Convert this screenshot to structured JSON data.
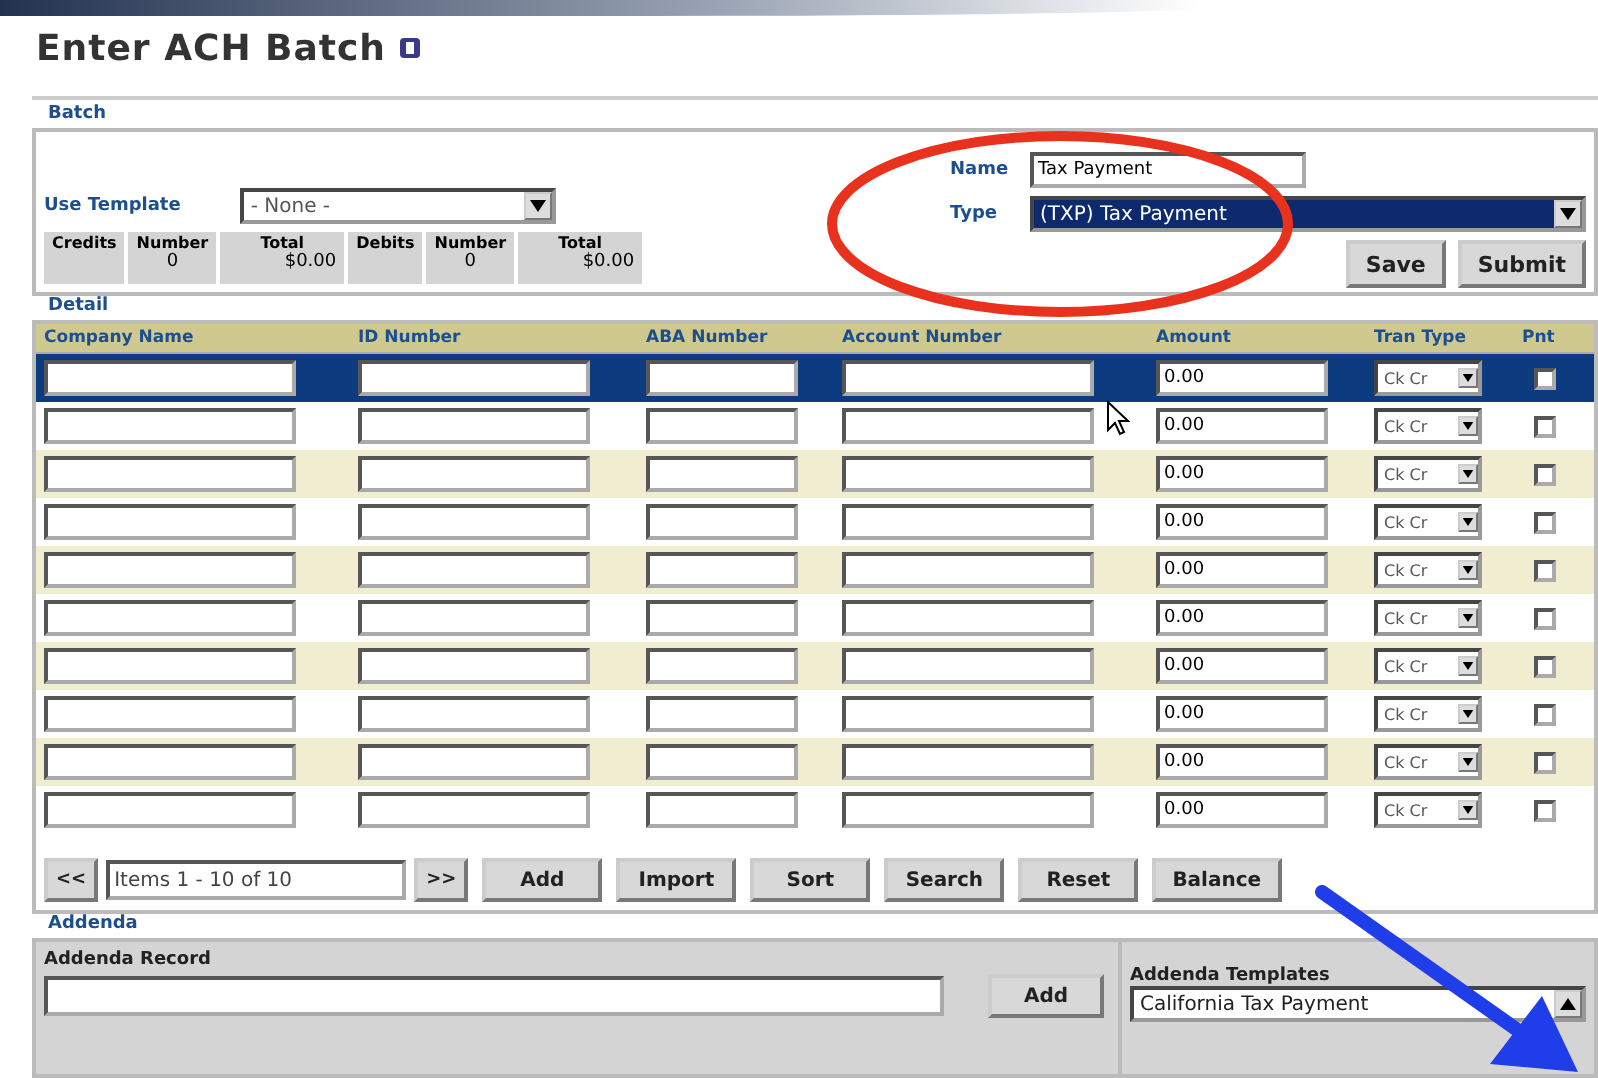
{
  "page": {
    "title": "Enter ACH Batch"
  },
  "batch": {
    "section_label": "Batch",
    "template_label": "Use Template",
    "template_value": "- None -",
    "name_label": "Name",
    "name_value": "Tax Payment",
    "type_label": "Type",
    "type_value": "(TXP) Tax Payment",
    "totals": [
      {
        "label": "Credits"
      },
      {
        "label": "Number",
        "value": "0"
      },
      {
        "label": "Total",
        "value": "$0.00"
      },
      {
        "label": "Debits"
      },
      {
        "label": "Number",
        "value": "0"
      },
      {
        "label": "Total",
        "value": "$0.00"
      }
    ],
    "buttons": [
      "Save",
      "Submit"
    ]
  },
  "detail": {
    "section_label": "Detail",
    "columns": [
      "Company Name",
      "ID Number",
      "ABA Number",
      "Account Number",
      "Amount",
      "Tran Type",
      "Pnt"
    ],
    "rows": [
      {
        "selected": true,
        "amount": "0.00",
        "tran_type": "Ck Cr",
        "pnt": false
      },
      {
        "selected": false,
        "amount": "0.00",
        "tran_type": "Ck Cr",
        "pnt": false
      },
      {
        "selected": false,
        "amount": "0.00",
        "tran_type": "Ck Cr",
        "pnt": false
      },
      {
        "selected": false,
        "amount": "0.00",
        "tran_type": "Ck Cr",
        "pnt": false
      },
      {
        "selected": false,
        "amount": "0.00",
        "tran_type": "Ck Cr",
        "pnt": false
      },
      {
        "selected": false,
        "amount": "0.00",
        "tran_type": "Ck Cr",
        "pnt": false
      },
      {
        "selected": false,
        "amount": "0.00",
        "tran_type": "Ck Cr",
        "pnt": false
      },
      {
        "selected": false,
        "amount": "0.00",
        "tran_type": "Ck Cr",
        "pnt": false
      },
      {
        "selected": false,
        "amount": "0.00",
        "tran_type": "Ck Cr",
        "pnt": false
      },
      {
        "selected": false,
        "amount": "0.00",
        "tran_type": "Ck Cr",
        "pnt": false
      }
    ],
    "pager": {
      "prev": "<<",
      "info": "Items 1 - 10 of 10",
      "next": ">>"
    },
    "buttons": [
      "Add",
      "Import",
      "Sort",
      "Search",
      "Reset",
      "Balance"
    ]
  },
  "addenda": {
    "section_label": "Addenda",
    "record_label": "Addenda Record",
    "add_button": "Add",
    "templates_label": "Addenda Templates",
    "templates_value": "California Tax Payment"
  }
}
